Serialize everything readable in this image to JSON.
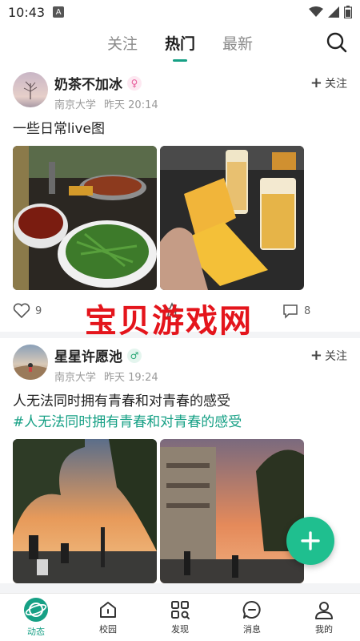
{
  "status_bar": {
    "time": "10:43",
    "notification_icon": "A"
  },
  "top_nav": {
    "tabs": [
      {
        "label": "关注"
      },
      {
        "label": "热门"
      },
      {
        "label": "最新"
      }
    ],
    "active_tab": "热门",
    "search_icon": "search-icon"
  },
  "posts": [
    {
      "username": "奶茶不加冰",
      "gender": "female",
      "school": "南京大学",
      "time": "昨天 20:14",
      "follow_label": "关注",
      "text": "一些日常live图",
      "topic": "",
      "like_count": "9",
      "comment_count": "8"
    },
    {
      "username": "星星许愿池",
      "gender": "male",
      "school": "南京大学",
      "time": "昨天 19:24",
      "follow_label": "关注",
      "text": "人无法同时拥有青春和对青春的感受",
      "topic": "#人无法同时拥有青春和对青春的感受"
    }
  ],
  "watermark": "宝贝游戏网",
  "fab_icon": "plus-icon",
  "bottom_nav": {
    "items": [
      {
        "label": "动态",
        "icon": "planet-icon",
        "active": true
      },
      {
        "label": "校园",
        "icon": "home-icon",
        "active": false
      },
      {
        "label": "发现",
        "icon": "discover-icon",
        "active": false
      },
      {
        "label": "消息",
        "icon": "message-icon",
        "active": false
      },
      {
        "label": "我的",
        "icon": "profile-icon",
        "active": false
      }
    ]
  },
  "colors": {
    "accent": "#16a085",
    "fab": "#1fbf8f",
    "watermark": "#e4151c"
  }
}
